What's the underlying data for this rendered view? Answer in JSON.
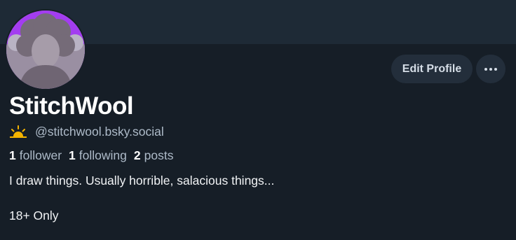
{
  "profile": {
    "display_name": "StitchWool",
    "handle": "@stitchwool.bsky.social",
    "handle_icon": "sunrise-icon",
    "avatar_ring_color": "#a33df0"
  },
  "actions": {
    "edit_profile_label": "Edit Profile",
    "more_icon": "more-horizontal-icon"
  },
  "stats": {
    "followers_count": "1",
    "followers_label": "follower",
    "following_count": "1",
    "following_label": "following",
    "posts_count": "2",
    "posts_label": "posts"
  },
  "bio": {
    "line1": "I draw things. Usually horrible, salacious things...",
    "line2": "18+ Only"
  },
  "colors": {
    "background": "#161e27",
    "banner": "#1e2a36",
    "button_bg": "#232e3b",
    "muted_text": "#aebbc9",
    "sunrise_icon": "#f5b400"
  }
}
